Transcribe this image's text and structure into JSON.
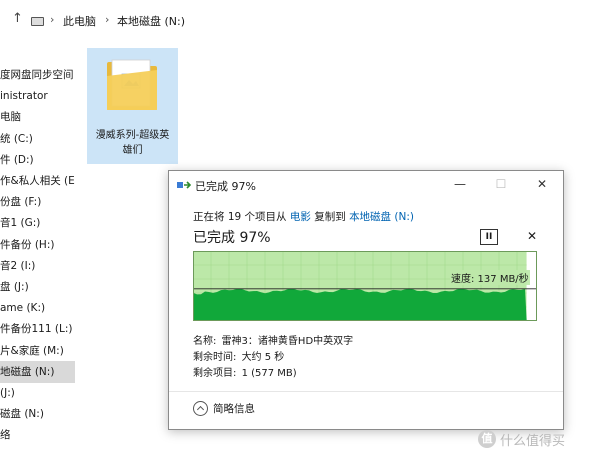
{
  "breadcrumb": {
    "items": [
      "此电脑",
      "本地磁盘 (N:)"
    ]
  },
  "sidebar": {
    "items": [
      {
        "label": "度网盘同步空间",
        "selected": false
      },
      {
        "label": "inistrator",
        "selected": false
      },
      {
        "label": "电脑",
        "selected": false
      },
      {
        "label": "统 (C:)",
        "selected": false
      },
      {
        "label": "件 (D:)",
        "selected": false
      },
      {
        "label": "作&私人相关 (E",
        "selected": false
      },
      {
        "label": "份盘 (F:)",
        "selected": false
      },
      {
        "label": "音1 (G:)",
        "selected": false
      },
      {
        "label": "件备份 (H:)",
        "selected": false
      },
      {
        "label": "音2 (I:)",
        "selected": false
      },
      {
        "label": "盘 (J:)",
        "selected": false
      },
      {
        "label": "ame (K:)",
        "selected": false
      },
      {
        "label": "件备份111 (L:)",
        "selected": false
      },
      {
        "label": "片&家庭 (M:)",
        "selected": false
      },
      {
        "label": "地磁盘 (N:)",
        "selected": true
      },
      {
        "label": "(J:)",
        "selected": false
      },
      {
        "label": "磁盘 (N:)",
        "selected": false
      },
      {
        "label": "络",
        "selected": false
      }
    ]
  },
  "folder": {
    "label_line1": "漫威系列-超级英",
    "label_line2": "雄们"
  },
  "dialog": {
    "title": "已完成 97%",
    "minimize": "—",
    "maximize": "☐",
    "close": "✕",
    "status_prefix": "正在将 19 个项目从 ",
    "source_link": "电影",
    "status_middle": " 复制到 ",
    "dest_link": "本地磁盘 (N:)",
    "progress_text": "已完成 97%",
    "progress_fraction": 0.97,
    "pause_label": "II",
    "cancel_label": "✕",
    "speed_text": "速度: 137 MB/秒",
    "speed_level_fraction": 0.46,
    "name_label": "名称:",
    "name_value": "雷神3：诸神黄昏HD中英双字",
    "time_label": "剩余时间:",
    "time_value": "大约 5 秒",
    "items_label": "剩余项目:",
    "items_value": "1 (577 MB)",
    "more_info": "简略信息"
  },
  "watermark": {
    "badge": "值",
    "text": "什么值得买"
  },
  "colors": {
    "graph_bg": "#bce8a8",
    "graph_grid": "#a3d98c",
    "graph_fill": "#11a83a",
    "graph_border": "#6c9a5a",
    "selection": "#cce4f7",
    "link": "#0063b1"
  }
}
